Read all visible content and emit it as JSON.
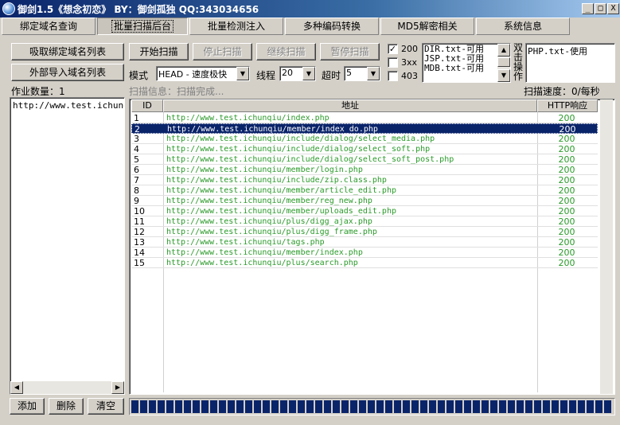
{
  "window": {
    "title": "御剑1.5《想念初恋》 BY：御剑孤独 QQ:343034656",
    "minimize": "_",
    "maximize": "□",
    "close": "X"
  },
  "tabs": [
    {
      "label": "绑定域名查询",
      "active": false
    },
    {
      "label": "批量扫描后台",
      "active": true
    },
    {
      "label": "批量检测注入",
      "active": false
    },
    {
      "label": "多种编码转换",
      "active": false
    },
    {
      "label": "MD5解密相关",
      "active": false
    },
    {
      "label": "系统信息",
      "active": false
    }
  ],
  "left": {
    "fetch_button": "吸取绑定域名列表",
    "import_button": "外部导入域名列表",
    "task_count": "作业数量：1",
    "domains": [
      "http://www.test.ichunqiu"
    ],
    "add_button": "添加",
    "delete_button": "删除",
    "clear_button": "清空"
  },
  "controls": {
    "start": "开始扫描",
    "stop": "停止扫描",
    "resume": "继续扫描",
    "pause": "暂停扫描",
    "mode_label": "模式",
    "mode_value": "HEAD - 速度极快",
    "threads_label": "线程",
    "threads_value": "20",
    "timeout_label": "超时",
    "timeout_value": "5",
    "check_200": {
      "label": "200",
      "checked": true
    },
    "check_3xx": {
      "label": "3xx",
      "checked": false
    },
    "check_403": {
      "label": "403",
      "checked": false
    },
    "check_mark": "✓",
    "dicts": [
      "DIR.txt-可用",
      "JSP.txt-可用",
      "MDB.txt-可用"
    ],
    "dbl_click": "双击操作",
    "used_dicts": [
      "PHP.txt-使用"
    ],
    "scan_info": "扫描信息：扫描完成...",
    "scan_speed": "扫描速度：0/每秒"
  },
  "table": {
    "columns": [
      "ID",
      "地址",
      "HTTP响应"
    ],
    "selected_index": 1,
    "rows": [
      {
        "id": "1",
        "url": "http://www.test.ichunqiu/index.php",
        "code": "200"
      },
      {
        "id": "2",
        "url": "http://www.test.ichunqiu/member/index_do.php",
        "code": "200"
      },
      {
        "id": "3",
        "url": "http://www.test.ichunqiu/include/dialog/select_media.php",
        "code": "200"
      },
      {
        "id": "4",
        "url": "http://www.test.ichunqiu/include/dialog/select_soft.php",
        "code": "200"
      },
      {
        "id": "5",
        "url": "http://www.test.ichunqiu/include/dialog/select_soft_post.php",
        "code": "200"
      },
      {
        "id": "6",
        "url": "http://www.test.ichunqiu/member/login.php",
        "code": "200"
      },
      {
        "id": "7",
        "url": "http://www.test.ichunqiu/include/zip.class.php",
        "code": "200"
      },
      {
        "id": "8",
        "url": "http://www.test.ichunqiu/member/article_edit.php",
        "code": "200"
      },
      {
        "id": "9",
        "url": "http://www.test.ichunqiu/member/reg_new.php",
        "code": "200"
      },
      {
        "id": "10",
        "url": "http://www.test.ichunqiu/member/uploads_edit.php",
        "code": "200"
      },
      {
        "id": "11",
        "url": "http://www.test.ichunqiu/plus/digg_ajax.php",
        "code": "200"
      },
      {
        "id": "12",
        "url": "http://www.test.ichunqiu/plus/digg_frame.php",
        "code": "200"
      },
      {
        "id": "13",
        "url": "http://www.test.ichunqiu/tags.php",
        "code": "200"
      },
      {
        "id": "14",
        "url": "http://www.test.ichunqiu/member/index.php",
        "code": "200"
      },
      {
        "id": "15",
        "url": "http://www.test.ichunqiu/plus/search.php",
        "code": "200"
      }
    ]
  },
  "progress": {
    "fraction": 1.0
  },
  "colors": {
    "accent": "#0a246a",
    "ok_text": "#2a9a2a"
  }
}
